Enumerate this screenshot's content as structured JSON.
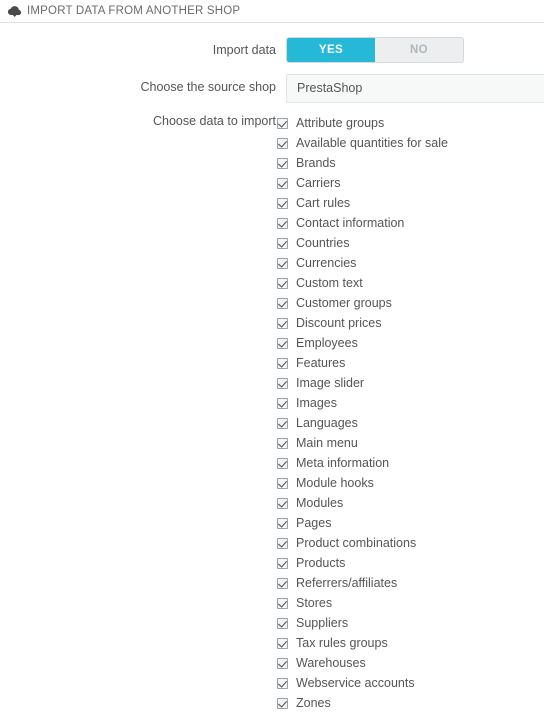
{
  "header": {
    "icon": "cloud-download-icon",
    "title": "IMPORT DATA FROM ANOTHER SHOP"
  },
  "form": {
    "import_data": {
      "label": "Import data",
      "yes_label": "YES",
      "no_label": "NO",
      "value": "YES"
    },
    "source_shop": {
      "label": "Choose the source shop",
      "value": "PrestaShop"
    },
    "data_to_import": {
      "label": "Choose data to import",
      "items": [
        {
          "label": "Attribute groups",
          "checked": true
        },
        {
          "label": "Available quantities for sale",
          "checked": true
        },
        {
          "label": "Brands",
          "checked": true
        },
        {
          "label": "Carriers",
          "checked": true
        },
        {
          "label": "Cart rules",
          "checked": true
        },
        {
          "label": "Contact information",
          "checked": true
        },
        {
          "label": "Countries",
          "checked": true
        },
        {
          "label": "Currencies",
          "checked": true
        },
        {
          "label": "Custom text",
          "checked": true
        },
        {
          "label": "Customer groups",
          "checked": true
        },
        {
          "label": "Discount prices",
          "checked": true
        },
        {
          "label": "Employees",
          "checked": true
        },
        {
          "label": "Features",
          "checked": true
        },
        {
          "label": "Image slider",
          "checked": true
        },
        {
          "label": "Images",
          "checked": true
        },
        {
          "label": "Languages",
          "checked": true
        },
        {
          "label": "Main menu",
          "checked": true
        },
        {
          "label": "Meta information",
          "checked": true
        },
        {
          "label": "Module hooks",
          "checked": true
        },
        {
          "label": "Modules",
          "checked": true
        },
        {
          "label": "Pages",
          "checked": true
        },
        {
          "label": "Product combinations",
          "checked": true
        },
        {
          "label": "Products",
          "checked": true
        },
        {
          "label": "Referrers/affiliates",
          "checked": true
        },
        {
          "label": "Stores",
          "checked": true
        },
        {
          "label": "Suppliers",
          "checked": true
        },
        {
          "label": "Tax rules groups",
          "checked": true
        },
        {
          "label": "Warehouses",
          "checked": true
        },
        {
          "label": "Webservice accounts",
          "checked": true
        },
        {
          "label": "Zones",
          "checked": true
        }
      ]
    }
  },
  "colors": {
    "accent": "#25b9d7",
    "switch_off_bg": "#eceeef",
    "text": "#555555",
    "header_text": "#6b6b6b",
    "border": "#e0e3e4",
    "select_bg": "#f7f8f8"
  }
}
